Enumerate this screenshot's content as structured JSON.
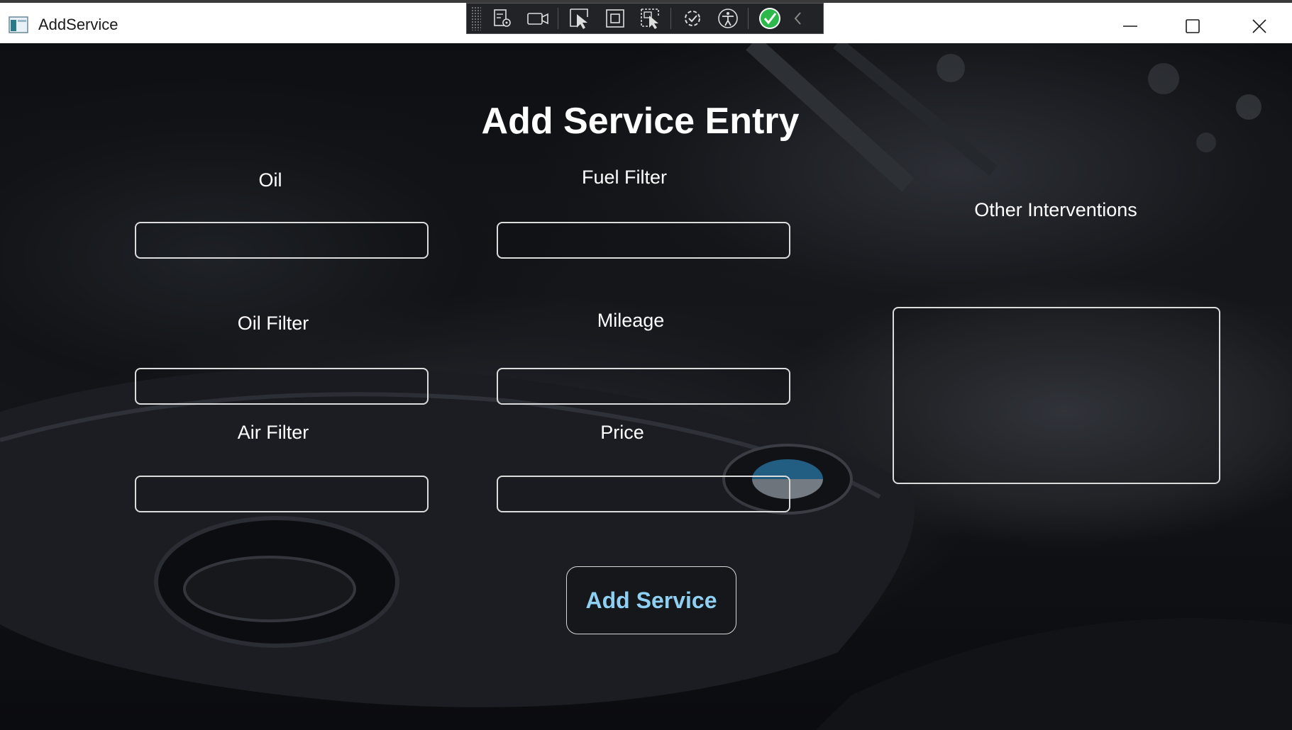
{
  "window": {
    "title": "AddService",
    "controls": {
      "minimize": "minimize-icon",
      "maximize": "maximize-icon",
      "close": "close-icon"
    }
  },
  "devtools_toolbar": {
    "icons": [
      "live-visual-tree-icon",
      "record-icon",
      "select-element-icon",
      "display-layout-adorners-icon",
      "track-focus-icon",
      "hot-reload-icon",
      "accessibility-icon",
      "binding-failures-ok-icon",
      "collapse-chevron-icon"
    ]
  },
  "form": {
    "heading": "Add Service Entry",
    "labels": {
      "oil": "Oil",
      "fuel_filter": "Fuel Filter",
      "oil_filter": "Oil Filter",
      "mileage": "Mileage",
      "air_filter": "Air Filter",
      "price": "Price",
      "other_interventions": "Other Interventions"
    },
    "values": {
      "oil": "",
      "fuel_filter": "",
      "oil_filter": "",
      "mileage": "",
      "air_filter": "",
      "price": "",
      "other_interventions": ""
    },
    "submit_label": "Add Service"
  },
  "colors": {
    "accent": "#8fd0f2",
    "field_border": "#dcdcdc",
    "text": "#ffffff",
    "titlebar": "#ffffff",
    "devtools_bg": "#222326",
    "check_green": "#2db84b"
  }
}
